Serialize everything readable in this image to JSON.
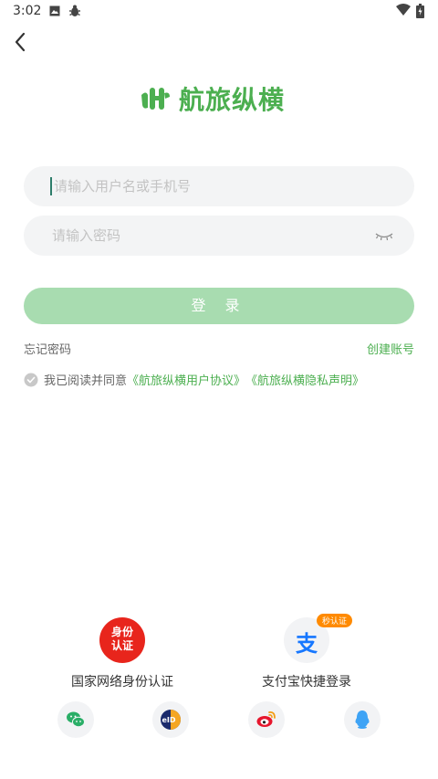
{
  "status_bar": {
    "time": "3:02"
  },
  "logo": {
    "text": "航旅纵横",
    "color": "#4caf50"
  },
  "login_form": {
    "username_placeholder": "请输入用户名或手机号",
    "password_placeholder": "请输入密码",
    "login_label": "登 录",
    "forgot_label": "忘记密码",
    "register_label": "创建账号"
  },
  "agreement": {
    "prefix": "我已阅读并同意",
    "user_agreement": "《航旅纵横用户协议》",
    "privacy_policy": "《航旅纵横隐私声明》"
  },
  "third_party": {
    "eid": {
      "label": "国家网络身份认证",
      "seal_line1": "身份",
      "seal_line2": "认证"
    },
    "alipay": {
      "label": "支付宝快捷登录",
      "glyph": "支",
      "badge": "秒认证"
    },
    "small_icons": [
      "wechat-icon",
      "eid-icon",
      "weibo-icon",
      "qq-icon"
    ]
  },
  "colors": {
    "accent": "#4caf50",
    "button_disabled": "#a8dcb0",
    "input_bg": "#f3f4f5",
    "eid_red": "#e8251c",
    "alipay_blue": "#1677ff",
    "badge_orange": "#ff8a00"
  }
}
